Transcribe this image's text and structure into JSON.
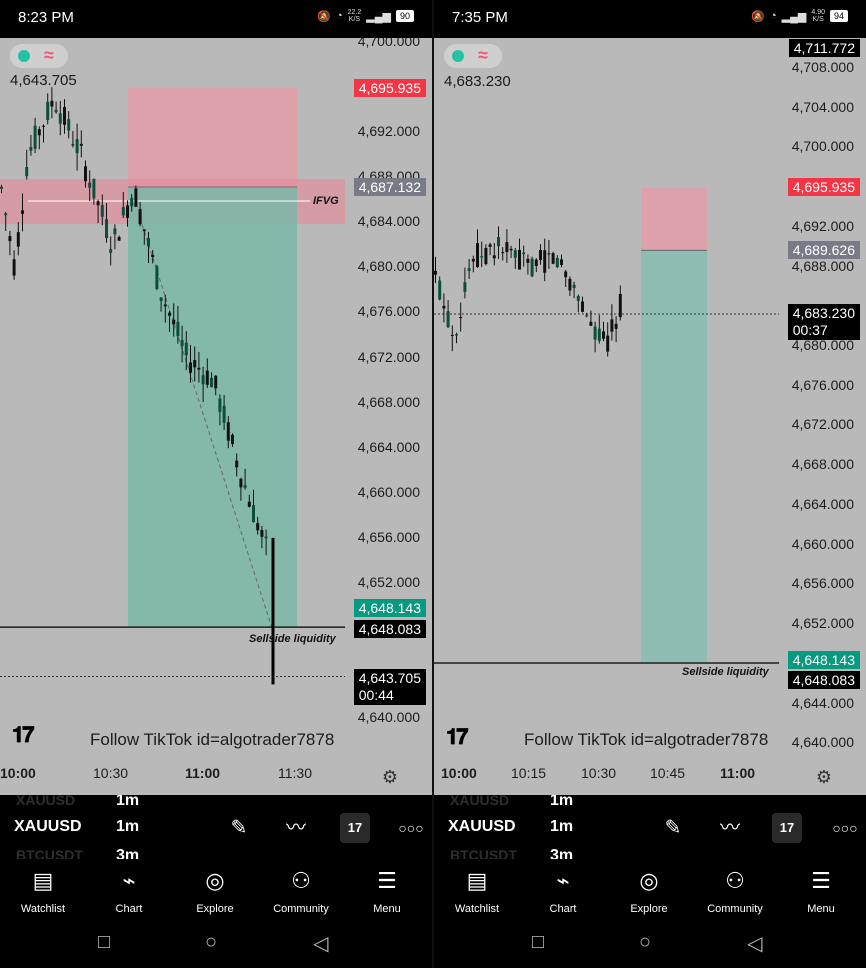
{
  "left": {
    "status": {
      "time": "8:23 PM",
      "speed_top": "22.2",
      "speed_unit": "K/S",
      "battery": "90"
    },
    "header": {
      "last_price": "4,643.705"
    },
    "y_ticks": [
      "4,700.000",
      "4,692.000",
      "4,688.000",
      "4,684.000",
      "4,680.000",
      "4,676.000",
      "4,672.000",
      "4,668.000",
      "4,664.000",
      "4,660.000",
      "4,656.000",
      "4,652.000",
      "4,640.000"
    ],
    "tags": {
      "stop": "4,695.935",
      "entry": "4,687.132",
      "target": "4,648.143",
      "liquidity": "4,648.083",
      "last": "4,643.705",
      "countdown": "00:44"
    },
    "annotations": {
      "ifvg": "IFVG",
      "liquidity": "Sellside liquidity"
    },
    "watermark": "Follow TikTok id=algotrader7878",
    "x_ticks": [
      {
        "label": "10:00",
        "bold": true
      },
      {
        "label": "10:30",
        "bold": false
      },
      {
        "label": "11:00",
        "bold": true
      },
      {
        "label": "11:30",
        "bold": false
      }
    ],
    "toolbar": {
      "ghost_prev_symbol": "XAUUSD",
      "ghost_prev_tf": "1m",
      "symbol": "XAUUSD",
      "timeframe": "1m",
      "ghost_next_symbol": "BTCUSDT",
      "ghost_next_tf": "3m"
    }
  },
  "right": {
    "status": {
      "time": "7:35 PM",
      "speed_top": "4.90",
      "speed_unit": "K/S",
      "battery": "94"
    },
    "header": {
      "last_price": "4,683.230"
    },
    "y_ticks": [
      "4,708.000",
      "4,704.000",
      "4,700.000",
      "4,692.000",
      "4,688.000",
      "4,680.000",
      "4,676.000",
      "4,672.000",
      "4,668.000",
      "4,664.000",
      "4,660.000",
      "4,656.000",
      "4,652.000",
      "4,644.000",
      "4,640.000"
    ],
    "tags": {
      "top": "4,711.772",
      "stop": "4,695.935",
      "entry": "4,689.626",
      "last": "4,683.230",
      "countdown": "00:37",
      "target": "4,648.143",
      "liquidity": "4,648.083"
    },
    "annotations": {
      "liquidity": "Sellside liquidity"
    },
    "watermark": "Follow TikTok id=algotrader7878",
    "x_ticks": [
      {
        "label": "10:00",
        "bold": true
      },
      {
        "label": "10:15",
        "bold": false
      },
      {
        "label": "10:30",
        "bold": false
      },
      {
        "label": "10:45",
        "bold": false
      },
      {
        "label": "11:00",
        "bold": true
      }
    ],
    "toolbar": {
      "ghost_prev_symbol": "XAUUSD",
      "ghost_prev_tf": "1m",
      "symbol": "XAUUSD",
      "timeframe": "1m",
      "ghost_next_symbol": "BTCUSDT",
      "ghost_next_tf": "3m"
    }
  },
  "nav": [
    "Watchlist",
    "Chart",
    "Explore",
    "Community",
    "Menu"
  ],
  "icons": {
    "drawing": "pen-icon",
    "indicators": "indicators-icon",
    "tv": "tradingview-icon",
    "more": "more-icon",
    "settings": "settings-icon"
  },
  "colors": {
    "stop_zone": "#f23645",
    "target_zone": "#089981",
    "chart_bg": "#b9b9b9"
  }
}
